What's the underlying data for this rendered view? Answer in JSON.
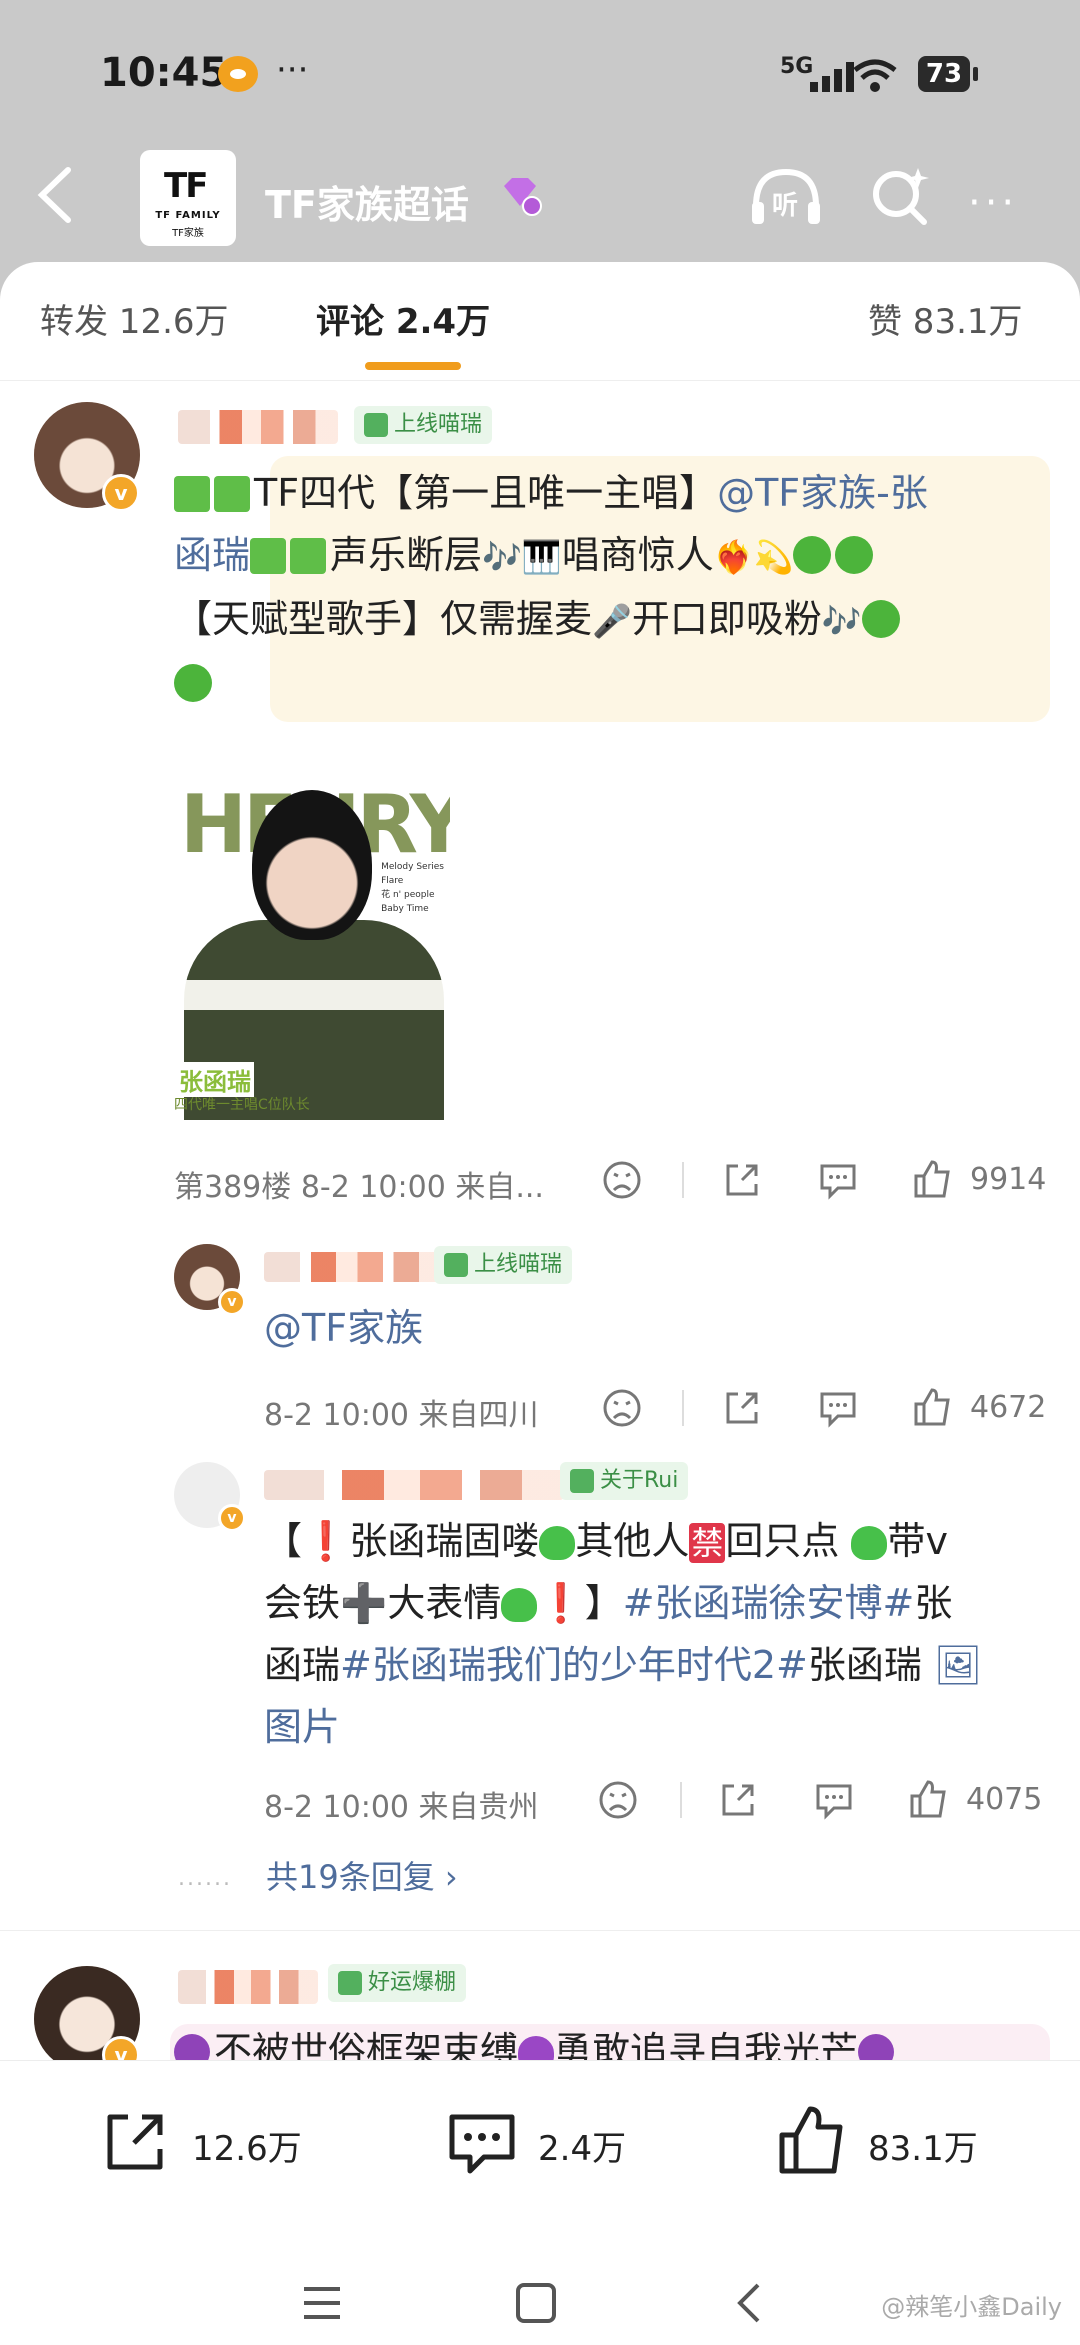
{
  "status": {
    "time": "10:45",
    "network": "5G",
    "battery": "73"
  },
  "header": {
    "logo_mark": "TF",
    "logo_text": "TF FAMILY",
    "logo_sub": "TF家族",
    "title": "TF家族超话",
    "listen_label": "听"
  },
  "tabs": {
    "repost": "转发 12.6万",
    "comments": "评论 2.4万",
    "likes": "赞 83.1万"
  },
  "comment1": {
    "fan_tag": "上线喵瑞",
    "line1_a": "TF四代【第一且唯一主唱】",
    "line1_link": "@TF家族-张",
    "line2_link": "函瑞",
    "line2_b": "声乐断层",
    "line2_c": "唱商惊人",
    "line3_a": "【天赋型歌手】仅需握麦",
    "line3_b": "开口即吸粉",
    "photo_big": "HENRY",
    "photo_name": "张函瑞",
    "photo_sub": "四代唯一主唱C位队长",
    "photo_tiny": "Melody Series\nFlare\n花 n' people\nBaby Time",
    "floor": "第389楼",
    "time": "8-2 10:00",
    "from": "来自...",
    "like_count": "9914"
  },
  "reply1": {
    "fan_tag": "上线喵瑞",
    "text": "@TF家族",
    "time": "8-2 10:00",
    "from": "来自四川",
    "like_count": "4672"
  },
  "reply2": {
    "fan_tag": "关于Rui",
    "l1_a": "【",
    "l1_b": "张函瑞固喽",
    "l1_c": "其他人",
    "l1_jin": "禁",
    "l1_d": "回只点 ",
    "l1_e": "带v",
    "l2_a": "会铁",
    "l2_b": "大表情",
    "l2_c": "】",
    "l2_link": "#张函瑞徐安博#",
    "l2_d": "张",
    "l3_a": "函瑞",
    "l3_link": "#张函瑞我们的少年时代2#",
    "l3_b": "张函瑞 ",
    "l4_link": "图片",
    "time": "8-2 10:00",
    "from": "来自贵州",
    "like_count": "4075"
  },
  "more_replies": "共19条回复 ›",
  "comment2": {
    "fan_tag": "好运爆棚",
    "text_a": "不被世俗框架束缚",
    "text_b": "勇敢追寻自我光芒"
  },
  "bottom": {
    "repost": "12.6万",
    "comments": "2.4万",
    "likes": "83.1万"
  },
  "watermark": "@辣笔小鑫Daily",
  "colors": {
    "accent": "#f09c1c",
    "link": "#4f6d9c",
    "tag_bg": "#e9f6ea"
  }
}
